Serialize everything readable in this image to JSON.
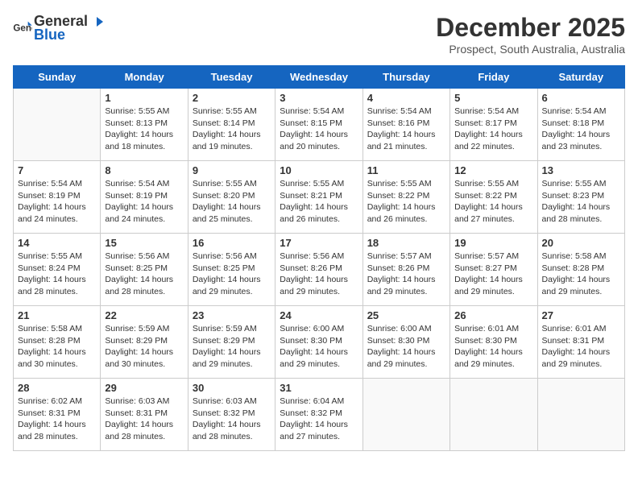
{
  "header": {
    "logo_line1": "General",
    "logo_line2": "Blue",
    "month": "December 2025",
    "location": "Prospect, South Australia, Australia"
  },
  "days_of_week": [
    "Sunday",
    "Monday",
    "Tuesday",
    "Wednesday",
    "Thursday",
    "Friday",
    "Saturday"
  ],
  "weeks": [
    [
      {
        "day": "",
        "info": ""
      },
      {
        "day": "1",
        "info": "Sunrise: 5:55 AM\nSunset: 8:13 PM\nDaylight: 14 hours\nand 18 minutes."
      },
      {
        "day": "2",
        "info": "Sunrise: 5:55 AM\nSunset: 8:14 PM\nDaylight: 14 hours\nand 19 minutes."
      },
      {
        "day": "3",
        "info": "Sunrise: 5:54 AM\nSunset: 8:15 PM\nDaylight: 14 hours\nand 20 minutes."
      },
      {
        "day": "4",
        "info": "Sunrise: 5:54 AM\nSunset: 8:16 PM\nDaylight: 14 hours\nand 21 minutes."
      },
      {
        "day": "5",
        "info": "Sunrise: 5:54 AM\nSunset: 8:17 PM\nDaylight: 14 hours\nand 22 minutes."
      },
      {
        "day": "6",
        "info": "Sunrise: 5:54 AM\nSunset: 8:18 PM\nDaylight: 14 hours\nand 23 minutes."
      }
    ],
    [
      {
        "day": "7",
        "info": "Sunrise: 5:54 AM\nSunset: 8:19 PM\nDaylight: 14 hours\nand 24 minutes."
      },
      {
        "day": "8",
        "info": "Sunrise: 5:54 AM\nSunset: 8:19 PM\nDaylight: 14 hours\nand 24 minutes."
      },
      {
        "day": "9",
        "info": "Sunrise: 5:55 AM\nSunset: 8:20 PM\nDaylight: 14 hours\nand 25 minutes."
      },
      {
        "day": "10",
        "info": "Sunrise: 5:55 AM\nSunset: 8:21 PM\nDaylight: 14 hours\nand 26 minutes."
      },
      {
        "day": "11",
        "info": "Sunrise: 5:55 AM\nSunset: 8:22 PM\nDaylight: 14 hours\nand 26 minutes."
      },
      {
        "day": "12",
        "info": "Sunrise: 5:55 AM\nSunset: 8:22 PM\nDaylight: 14 hours\nand 27 minutes."
      },
      {
        "day": "13",
        "info": "Sunrise: 5:55 AM\nSunset: 8:23 PM\nDaylight: 14 hours\nand 28 minutes."
      }
    ],
    [
      {
        "day": "14",
        "info": "Sunrise: 5:55 AM\nSunset: 8:24 PM\nDaylight: 14 hours\nand 28 minutes."
      },
      {
        "day": "15",
        "info": "Sunrise: 5:56 AM\nSunset: 8:25 PM\nDaylight: 14 hours\nand 28 minutes."
      },
      {
        "day": "16",
        "info": "Sunrise: 5:56 AM\nSunset: 8:25 PM\nDaylight: 14 hours\nand 29 minutes."
      },
      {
        "day": "17",
        "info": "Sunrise: 5:56 AM\nSunset: 8:26 PM\nDaylight: 14 hours\nand 29 minutes."
      },
      {
        "day": "18",
        "info": "Sunrise: 5:57 AM\nSunset: 8:26 PM\nDaylight: 14 hours\nand 29 minutes."
      },
      {
        "day": "19",
        "info": "Sunrise: 5:57 AM\nSunset: 8:27 PM\nDaylight: 14 hours\nand 29 minutes."
      },
      {
        "day": "20",
        "info": "Sunrise: 5:58 AM\nSunset: 8:28 PM\nDaylight: 14 hours\nand 29 minutes."
      }
    ],
    [
      {
        "day": "21",
        "info": "Sunrise: 5:58 AM\nSunset: 8:28 PM\nDaylight: 14 hours\nand 30 minutes."
      },
      {
        "day": "22",
        "info": "Sunrise: 5:59 AM\nSunset: 8:29 PM\nDaylight: 14 hours\nand 30 minutes."
      },
      {
        "day": "23",
        "info": "Sunrise: 5:59 AM\nSunset: 8:29 PM\nDaylight: 14 hours\nand 29 minutes."
      },
      {
        "day": "24",
        "info": "Sunrise: 6:00 AM\nSunset: 8:30 PM\nDaylight: 14 hours\nand 29 minutes."
      },
      {
        "day": "25",
        "info": "Sunrise: 6:00 AM\nSunset: 8:30 PM\nDaylight: 14 hours\nand 29 minutes."
      },
      {
        "day": "26",
        "info": "Sunrise: 6:01 AM\nSunset: 8:30 PM\nDaylight: 14 hours\nand 29 minutes."
      },
      {
        "day": "27",
        "info": "Sunrise: 6:01 AM\nSunset: 8:31 PM\nDaylight: 14 hours\nand 29 minutes."
      }
    ],
    [
      {
        "day": "28",
        "info": "Sunrise: 6:02 AM\nSunset: 8:31 PM\nDaylight: 14 hours\nand 28 minutes."
      },
      {
        "day": "29",
        "info": "Sunrise: 6:03 AM\nSunset: 8:31 PM\nDaylight: 14 hours\nand 28 minutes."
      },
      {
        "day": "30",
        "info": "Sunrise: 6:03 AM\nSunset: 8:32 PM\nDaylight: 14 hours\nand 28 minutes."
      },
      {
        "day": "31",
        "info": "Sunrise: 6:04 AM\nSunset: 8:32 PM\nDaylight: 14 hours\nand 27 minutes."
      },
      {
        "day": "",
        "info": ""
      },
      {
        "day": "",
        "info": ""
      },
      {
        "day": "",
        "info": ""
      }
    ]
  ]
}
